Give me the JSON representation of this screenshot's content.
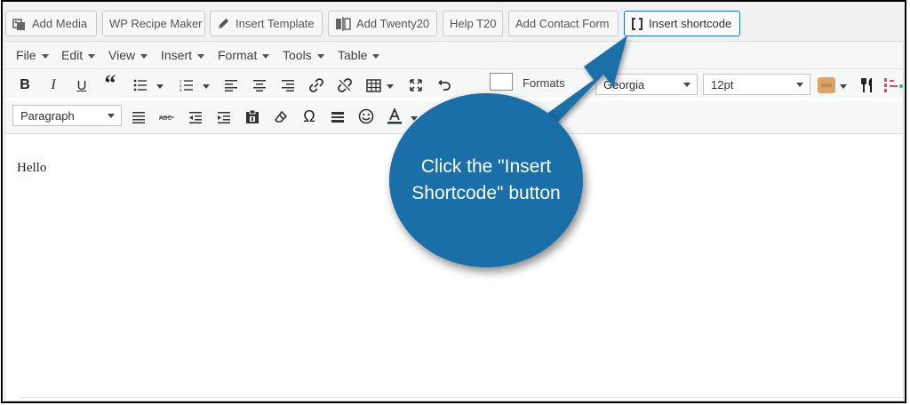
{
  "media_buttons": [
    {
      "label": "Add Media",
      "icon": "add-media-icon"
    },
    {
      "label": "WP Recipe Maker",
      "icon": ""
    },
    {
      "label": "Insert Template",
      "icon": "pencil-icon"
    },
    {
      "label": "Add Twenty20",
      "icon": "twenty20-icon"
    },
    {
      "label": "Help T20",
      "icon": ""
    },
    {
      "label": "Add Contact Form",
      "icon": ""
    },
    {
      "label": "Insert shortcode",
      "icon": "shortcode-brackets-icon"
    }
  ],
  "menubar": [
    "File",
    "Edit",
    "View",
    "Insert",
    "Format",
    "Tools",
    "Table"
  ],
  "toolbar": {
    "formats_label": "Formats",
    "font_family": "Georgia",
    "font_size": "12pt",
    "paragraph_format": "Paragraph",
    "omega": "Ω"
  },
  "content": {
    "text": "Hello"
  },
  "callout": {
    "text": "Click the \"Insert Shortcode\" button",
    "color": "#1a6fa8"
  }
}
